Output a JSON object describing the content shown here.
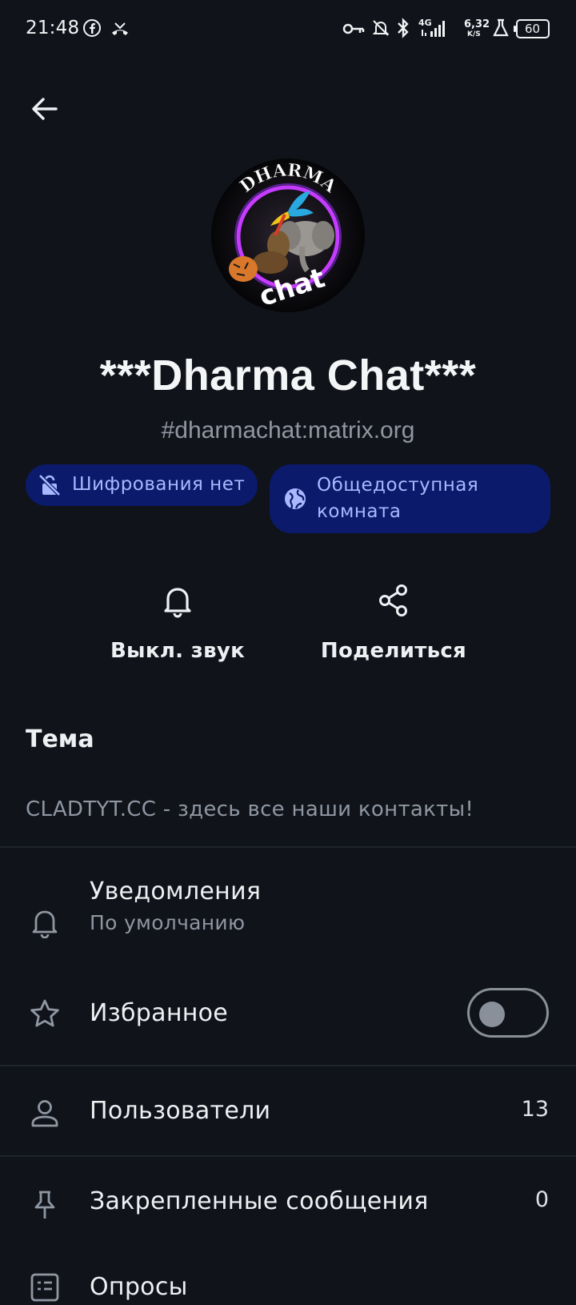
{
  "status_bar": {
    "time": "21:48",
    "network_type": "4G",
    "speed_value": "6,32",
    "speed_unit": "K/S",
    "battery": "60",
    "icons": [
      "facebook-icon",
      "missed-call-icon",
      "vpn-key-icon",
      "notifications-off-icon",
      "bluetooth-icon",
      "signal-icon",
      "lab-icon",
      "battery-icon"
    ]
  },
  "header": {
    "back_icon": "arrow-back-icon"
  },
  "room": {
    "avatar_texts": [
      "DHARMA",
      "chat"
    ],
    "title": "***Dharma Chat***",
    "alias": "#dharmachat:matrix.org",
    "badges": [
      {
        "label": "Шифрования нет",
        "icon": "lock-off-icon"
      },
      {
        "label_line1": "Общедоступная",
        "label_line2": "комната",
        "icon": "globe-icon"
      }
    ]
  },
  "actions": [
    {
      "label": "Выкл. звук",
      "icon": "bell-icon"
    },
    {
      "label": "Поделиться",
      "icon": "share-icon"
    }
  ],
  "topic": {
    "title": "Тема",
    "text": "CLADTYT.CC - здесь все наши контакты!"
  },
  "settings": {
    "notifications": {
      "label": "Уведомления",
      "sub": "По умолчанию",
      "icon": "bell-icon"
    },
    "favourite": {
      "label": "Избранное",
      "icon": "star-icon",
      "enabled": false
    },
    "people": {
      "label": "Пользователи",
      "count": "13",
      "icon": "user-icon"
    },
    "pinned": {
      "label": "Закрепленные сообщения",
      "count": "0",
      "icon": "pin-icon"
    },
    "polls": {
      "label": "Опросы",
      "icon": "poll-icon"
    }
  },
  "colors": {
    "background": "#101319",
    "badge_bg": "#0b1a6b",
    "badge_text": "#a9b8ff",
    "muted_text": "#8f97a3"
  }
}
